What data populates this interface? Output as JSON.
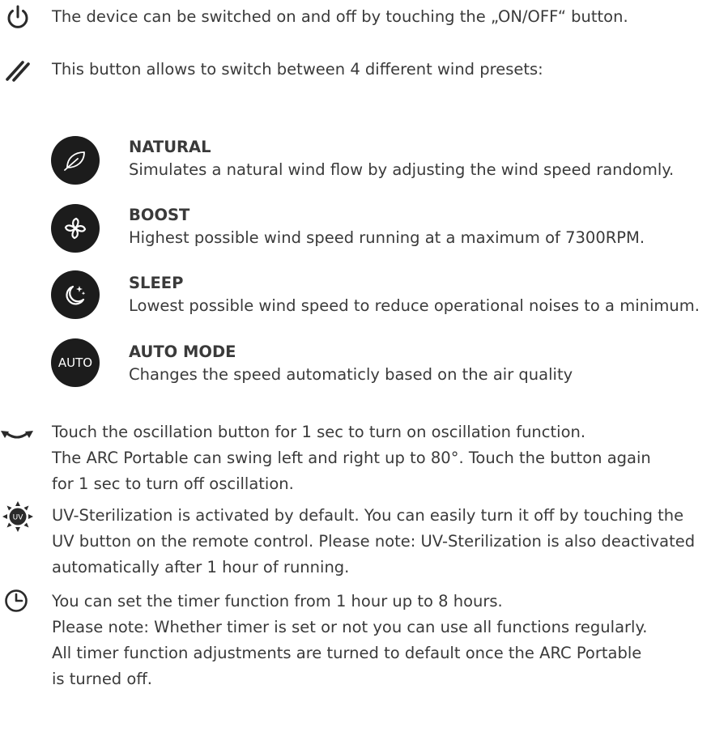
{
  "power": {
    "icon": "power-icon",
    "text": "The device can be switched on and off by touching the „ON/OFF“ button."
  },
  "wind": {
    "icon": "wind-slashes-icon",
    "text": "This button allows to switch between 4 different wind presets:"
  },
  "presets": [
    {
      "icon": "leaf-icon",
      "title": "NATURAL",
      "desc": "Simulates a natural wind flow by adjusting the wind speed randomly."
    },
    {
      "icon": "fan-swirl-icon",
      "title": "BOOST",
      "desc": "Highest possible wind speed running at a maximum of 7300RPM."
    },
    {
      "icon": "moon-stars-icon",
      "title": "SLEEP",
      "desc": "Lowest possible wind speed to reduce operational noises to a minimum."
    },
    {
      "icon": "auto-icon",
      "badge": "AUTO",
      "title": "AUTO MODE",
      "desc": "Changes the speed automaticly based on the air quality"
    }
  ],
  "oscillation": {
    "icon": "oscillation-arrows-icon",
    "lines": [
      "Touch the oscillation button for 1 sec to turn on oscillation function.",
      "The ARC Portable can swing left and right up to 80°. Touch the button again",
      "for 1 sec to turn off oscillation."
    ]
  },
  "uv": {
    "icon": "uv-sun-icon",
    "badge": "UV",
    "lines": [
      "UV-Sterilization is activated by default. You can easily turn it off by touching the",
      "UV button on the remote control. Please note: UV-Sterilization is also deactivated",
      "automatically after 1 hour of running."
    ]
  },
  "timer": {
    "icon": "clock-icon",
    "lines": [
      "You can set the timer function from 1 hour up to 8 hours.",
      "Please note: Whether timer is set or not you can use all functions regularly.",
      "All timer function adjustments are turned to default once the ARC Portable",
      "is turned off."
    ]
  },
  "colors": {
    "text": "#3a3a3a",
    "icon": "#2a2a2a",
    "circle": "#1c1c1c"
  }
}
